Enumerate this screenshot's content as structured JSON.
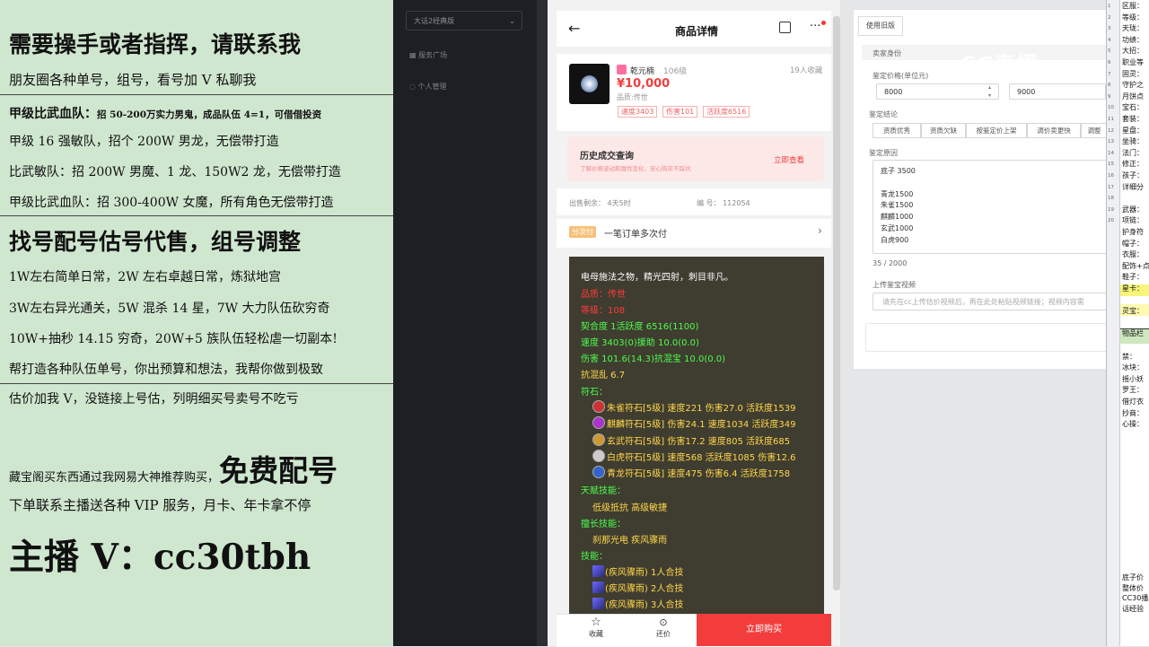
{
  "promo": {
    "line1": "需要操手或者指挥，请联系我",
    "line2": "朋友圈各种单号，组号，看号加 V 私聊我",
    "line3a": "甲级比武血队：",
    "line3b": "招 50-200万实力男鬼，成品队伍 4=1，可借借投资",
    "line4": "甲级 16 强敏队，招个 200W 男龙，无偿带打造",
    "line5": "比武敏队：招 200W 男魔、1 龙、150W2 龙，无偿带打造",
    "line6": "甲级比武血队：招 300-400W 女魔，所有角色无偿带打造",
    "line7": "找号配号估号代售，组号调整",
    "line8": "1W左右简单日常，2W 左右卓越日常，炼狱地宫",
    "line9": "3W左右异光通关，5W 混杀 14 星，7W 大力队伍砍穷奇",
    "line10": "10W+抽秒 14.15 穷奇，20W+5 族队伍轻松虐一切副本!",
    "line11": "帮打造各种队伍单号，你出预算和想法，我帮你做到极致",
    "line12": "估价加我 V，没链接上号估，列明细买号卖号不吃亏",
    "line13a": "藏宝阁买东西通过我网易大神推荐购买，",
    "line13b": "免费配号",
    "line14": "下单联系主播送各种 VIP 服务，月卡、年卡拿不停",
    "line15": "主播 V：cc30tbh"
  },
  "sidebar": {
    "select": "大话2经典版",
    "items": [
      "服务广场",
      "个人管理"
    ]
  },
  "mobile": {
    "title": "商品详情",
    "role_name": "乾元楠",
    "level": "106级",
    "favorites": "19人收藏",
    "price": "¥10,000",
    "quality": "品质:传世",
    "tags": [
      "速度3403",
      "伤害101",
      "活跃度6516"
    ],
    "history_title": "历史成交查询",
    "history_sub": "了解价格波动和属性变化，安心购买不踩坑",
    "history_btn": "立即查看",
    "remain": "出售剩余：  4天5时",
    "serial": "编  号：  112054",
    "inst_badge": "分次付",
    "inst_text": "一笔订单多次付",
    "desc": "电母施法之物，精光四射，刺目非凡。",
    "red1": "品质：传世",
    "red2": "等级：108",
    "stat1": "契合度      1活跃度  6516(1100)",
    "stat2": "速度      3403(0)援助      10.0(0.0)",
    "stat3": "伤害    101.6(14.3)抗混宝    10.0(0.0)",
    "stat4": "抗混乱 6.7",
    "rune_head": "符石：",
    "runes": [
      "朱雀符石[5级] 速度221 伤害27.0 活跃度1539",
      "麒麟符石[5级] 伤害24.1 速度1034 活跃度349",
      "玄武符石[5级] 伤害17.2 速度805 活跃度685",
      "白虎符石[5级] 速度568 活跃度1085 伤害12.6",
      "青龙符石[5级] 速度475 伤害6.4 活跃度1758"
    ],
    "talent_head": "天赋技能：",
    "talents": "低级抵抗     高级敏捷",
    "special_head": "擅长技能：",
    "specials": "刹那光电     疾风骤雨",
    "skill_head": "技能：",
    "skills": [
      "(疾风骤雨) 1人合技",
      "(疾风骤雨) 2人合技",
      "(疾风骤雨) 3人合技"
    ],
    "fav_label": "收藏",
    "bargain_label": "还价",
    "buy_label": "立即购买"
  },
  "form": {
    "tab": "使用旧版",
    "section": "卖家身份",
    "price_label": "鉴定价格(单位元)",
    "price_low": "8000",
    "price_high": "9000",
    "conclusion_label": "鉴定结论",
    "conclusion_tags": [
      "资质优秀",
      "资质欠缺",
      "按鉴定价上架",
      "调价卖更快",
      "调整"
    ],
    "reason_label": "鉴定原因",
    "reason_text": "底子 3500\n\n青龙1500\n朱雀1500\n麒麟1000\n玄武1000\n白虎900",
    "counter": "35 / 2000",
    "video_label": "上传鉴宝视频",
    "video_placeholder": "请先在cc上传估价视频后，再在此处粘贴视频链接；视频内容需"
  },
  "watermark": "CC直播",
  "sheet": {
    "rows": [
      "区服：",
      "等级：",
      "天珑：",
      "功绩：",
      "大招：",
      "职业等",
      "固灵：",
      "守护之",
      "月饼点",
      "宝石：",
      "套装：",
      "星盘：",
      "坐骑：",
      "法门：",
      "修正：",
      "孩子：",
      "详细分",
      "",
      "武器：",
      "项链：",
      "护身符",
      "帽子：",
      "衣服：",
      "配饰+点",
      "鞋子：",
      "星卡：",
      "",
      "灵宝：",
      "",
      "物品栏",
      "",
      "禁：",
      "冰块：",
      "摇小妖",
      "罗王：",
      "借灯衣",
      "抄商：",
      "心操："
    ],
    "bottom": [
      "底子价",
      "整体价",
      "CC30播",
      "话经验"
    ],
    "nums": [
      "1",
      "2",
      "3",
      "4",
      "5",
      "6",
      "7",
      "8",
      "9",
      "10",
      "11",
      "12",
      "13",
      "14",
      "15",
      "16",
      "17",
      "18",
      "19",
      "20"
    ]
  }
}
